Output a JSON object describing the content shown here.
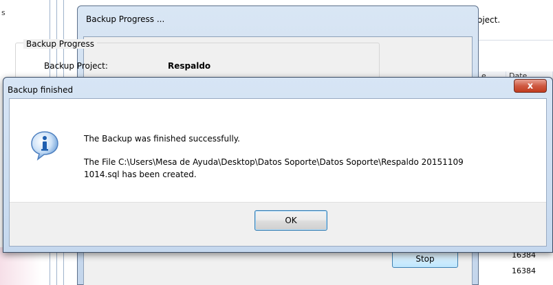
{
  "background": {
    "left_fragment": "s",
    "right_text": "oject.",
    "col_headers": [
      "e",
      "Date"
    ],
    "numbers": [
      "16384",
      "16384"
    ]
  },
  "progress_window": {
    "title": "Backup Progress ...",
    "group_label": "Backup Progress",
    "project_label": "Backup Project:",
    "project_value": "Respaldo",
    "stop_label": "Stop"
  },
  "dialog": {
    "title": "Backup finished",
    "close_glyph": "x",
    "message1": "The Backup was finished successfully.",
    "message2_line1": "The File C:\\Users\\Mesa de Ayuda\\Desktop\\Datos Soporte\\Datos Soporte\\Respaldo 20151109",
    "message2_line2": "1014.sql has been created.",
    "ok_label": "OK",
    "icon": "info-icon"
  },
  "colors": {
    "accent": "#3c7fb1",
    "close_red": "#c13c1f",
    "info_blue": "#2a6fc2"
  }
}
